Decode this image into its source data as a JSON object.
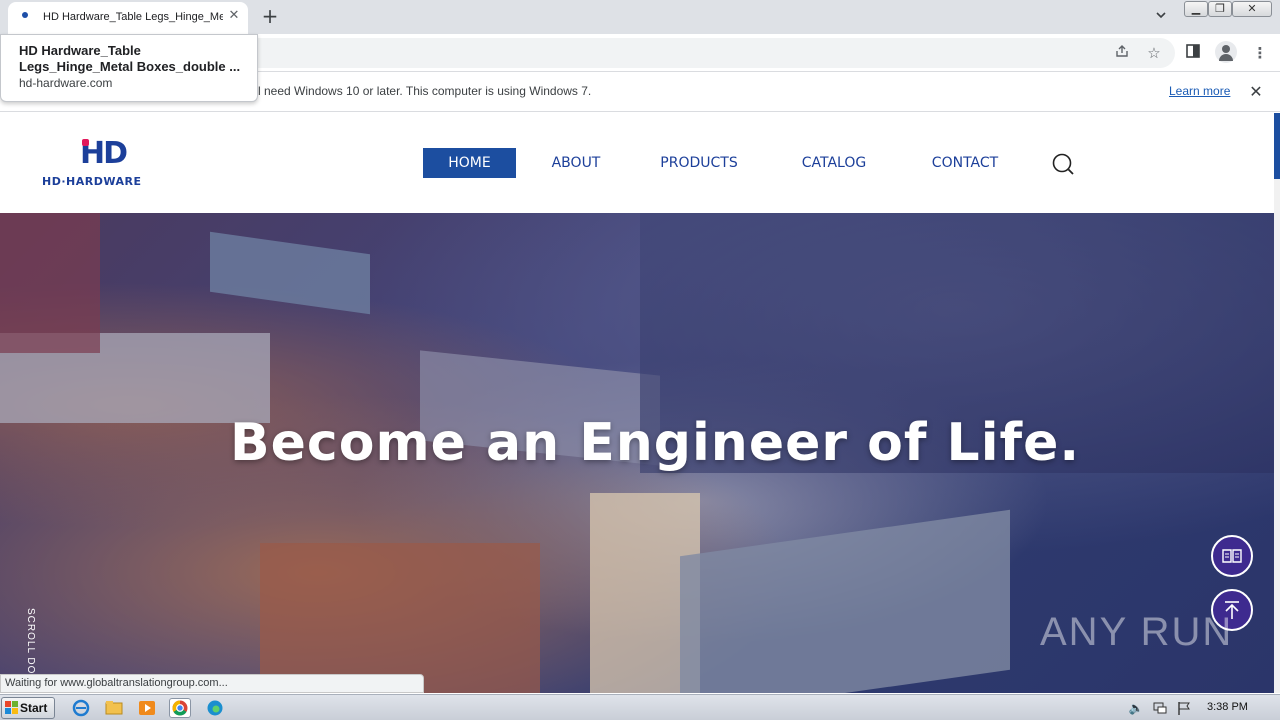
{
  "browser": {
    "tab_title": "HD Hardware_Table Legs_Hinge_Metal Boxes_double",
    "hover_card": {
      "title": "HD Hardware_Table Legs_Hinge_Metal Boxes_double ...",
      "url": "hd-hardware.com"
    },
    "infobar": {
      "message": "l need Windows 10 or later. This computer is using Windows 7.",
      "link": "Learn more"
    },
    "status": "Waiting for www.globaltranslationgroup.com..."
  },
  "site": {
    "logo_mark": "HD",
    "logo_text": "HD·HARDWARE",
    "nav": [
      {
        "label": "HOME"
      },
      {
        "label": "ABOUT"
      },
      {
        "label": "PRODUCTS"
      },
      {
        "label": "CATALOG"
      },
      {
        "label": "CONTACT"
      }
    ],
    "hero_title": "Become an Engineer of Life.",
    "scroll_label": "SCROLL DOW",
    "watermark": "ANY RUN"
  },
  "taskbar": {
    "start_label": "Start",
    "clock": "3:38 PM"
  },
  "colors": {
    "brand_blue": "#1c4ea0",
    "logo_pink": "#e2185b",
    "float_button": "#3e2a8f"
  }
}
